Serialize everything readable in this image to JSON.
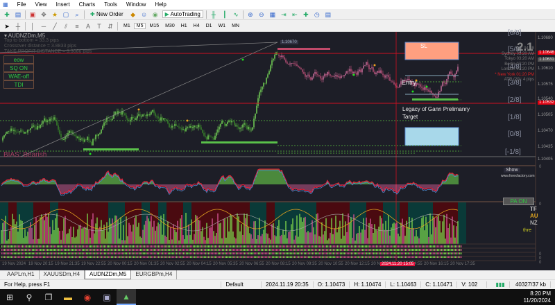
{
  "menu": [
    "File",
    "View",
    "Insert",
    "Charts",
    "Tools",
    "Window",
    "Help"
  ],
  "toolbar": {
    "new_order": "New Order",
    "autotrading": "AutoTrading"
  },
  "timeframes": [
    "M1",
    "M5",
    "M15",
    "M30",
    "H1",
    "H4",
    "D1",
    "W1",
    "MN"
  ],
  "active_timeframe": "M5",
  "chart": {
    "symbol": "AUDNZDm,M5",
    "info_lines": [
      "Top to bottom = 33.3 pips",
      "Crossover distance = 3.8833 pips",
      "TAKE PROFIT DISTANCE = 3.3086 pips"
    ],
    "indicator_buttons": [
      "eow",
      "SQ ON",
      "WAE-off",
      "TDI"
    ],
    "bias": "BIAS: Bearish",
    "sl_label": "SL",
    "entry_label": "Entry",
    "target_label_1": "Legacy of Gann Prelimanry",
    "target_label_2": "Target",
    "price_tag": "1.10670",
    "big_value": "2.1",
    "gann_levels": [
      "[6/8]",
      "[5/8]",
      "[4/8]",
      "[3/8]",
      "[2/8]",
      "[1/8]",
      "[0/8]",
      "[-1/8]"
    ],
    "sessions": [
      {
        "name": "Bar",
        "time": "04:48"
      },
      {
        "name": "Sydney",
        "time": "03:20 AM"
      },
      {
        "name": "Tokyo",
        "time": "03:20 AM"
      },
      {
        "name": "Berlin",
        "time": "07:20 PM"
      },
      {
        "name": "London",
        "time": "07:20 PM"
      },
      {
        "name": "* New York",
        "time": "01:20 PM"
      }
    ],
    "atr": "ATR (20): 4 pips",
    "show_button": "Show",
    "pa_button": "PA ON",
    "site": "www.forexfactory.com",
    "price_axis": [
      "1.10680",
      "1.10646",
      "1.10631",
      "1.10610",
      "1.10575",
      "1.10540",
      "1.10532",
      "1.10505",
      "1.10470",
      "1.10435",
      "1.10405"
    ],
    "sub_labels": [
      "TF",
      "AU",
      "NZ",
      "thre"
    ],
    "zero": "0",
    "time_axis": [
      "19 Nov 2024",
      "19 Nov 20:15",
      "19 Nov 21:35",
      "19 Nov 22:55",
      "20 Nov 00:15",
      "20 Nov 01:35",
      "20 Nov 02:55",
      "20 Nov 04:15",
      "20 Nov 05:35",
      "20 Nov 06:55",
      "20 Nov 08:15",
      "20 Nov 09:35",
      "20 Nov 10:55",
      "20 Nov 12:15",
      "20 Nov 13:35",
      "20 Nov 14:55",
      "20 Nov 16:15",
      "20 Nov 17:35"
    ],
    "cursor_time": "2024.11.20 15:05"
  },
  "tabs": [
    "AAPLm,H1",
    "XAUUSDm,H4",
    "AUDNZDm,M5",
    "EURGBPm,H4"
  ],
  "active_tab": "AUDNZDm,M5",
  "status": {
    "help": "For Help, press F1",
    "profile": "Default",
    "time": "2024.11.19 20:35",
    "open": "O: 1.10473",
    "high": "H: 1.10474",
    "low": "L: 1.10463",
    "close": "C: 1.10471",
    "volume": "V: 102",
    "traffic": "40327/37 kb"
  },
  "clock": {
    "time": "8:20 PM",
    "date": "11/20/2024"
  },
  "colors": {
    "bg": "#1d1e27",
    "bull": "#7be05a",
    "bear": "#c0507a",
    "red_line": "#d01020",
    "sl_box": "#ff9f80",
    "target_box": "#a8d8ea"
  }
}
